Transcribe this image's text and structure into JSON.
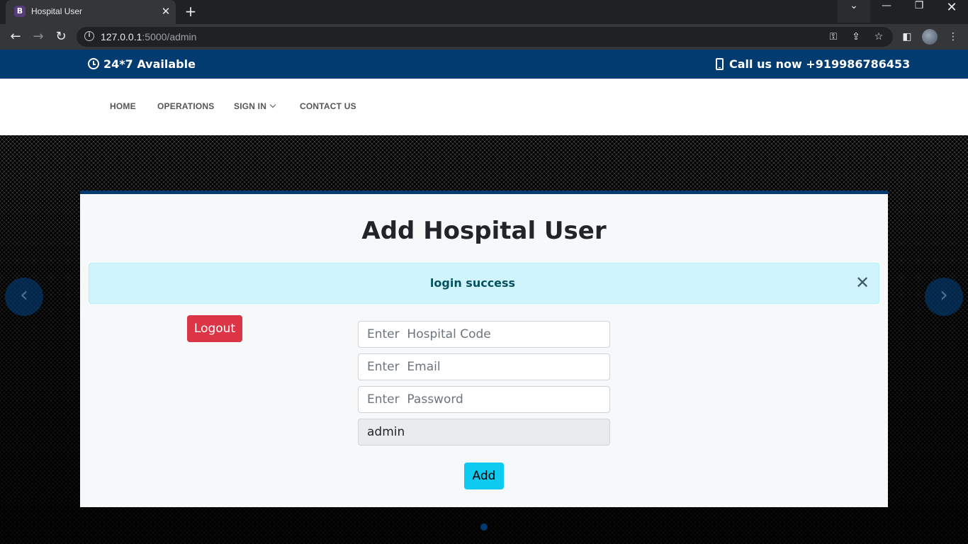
{
  "browser": {
    "tab_title": "Hospital User",
    "tab_favicon_letter": "B",
    "tab_close": "✕",
    "new_tab": "+",
    "url_host": "127.0.0.1",
    "url_path": ":5000/admin",
    "icons": [
      "back-arrow-icon",
      "forward-arrow-icon",
      "reload-icon",
      "info-icon",
      "key-icon",
      "share-icon",
      "star-icon",
      "sidebar-icon",
      "profile-avatar",
      "kebab-menu-icon"
    ]
  },
  "topbar": {
    "left_text": "24*7 Available",
    "right_text": "Call us now +919986786453",
    "color": "#023b70"
  },
  "nav": {
    "items": [
      "HOME",
      "OPERATIONS",
      "SIGN IN",
      "CONTACT US"
    ]
  },
  "card": {
    "title": "Add Hospital User",
    "alert_text": "login success",
    "logout_label": "Logout",
    "add_label": "Add",
    "fields": {
      "hospital_code_placeholder": "Enter  Hospital Code",
      "email_placeholder": "Enter  Email",
      "password_placeholder": "Enter  Password",
      "role_value": "admin"
    }
  },
  "colors": {
    "logout": "#dc3545",
    "add": "#0dcaf0",
    "alert_bg": "#cff4fc",
    "accent": "#023b70"
  }
}
